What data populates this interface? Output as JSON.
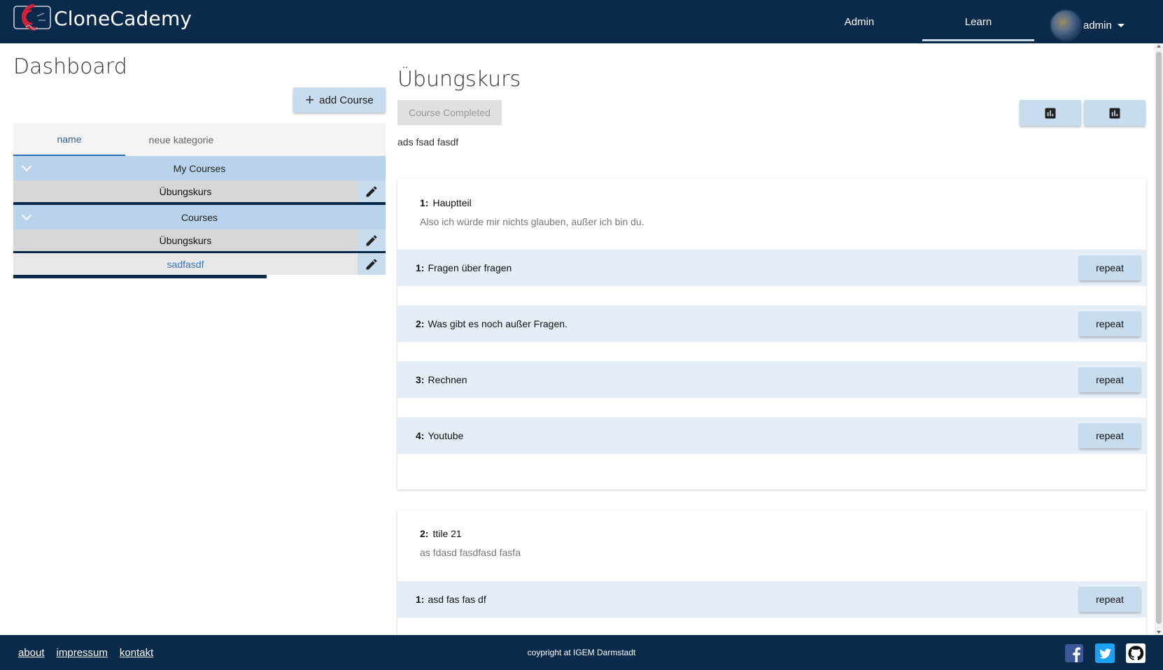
{
  "header": {
    "brand": "CloneCademy",
    "nav": {
      "admin": "Admin",
      "learn": "Learn"
    },
    "user": "admin"
  },
  "sidebar": {
    "title": "Dashboard",
    "add_course": "add Course",
    "tabs": [
      "name",
      "neue kategorie"
    ],
    "groups": [
      {
        "title": "My Courses",
        "items": [
          {
            "name": "Übungskurs",
            "progress": 1.0
          }
        ]
      },
      {
        "title": "Courses",
        "items": [
          {
            "name": "Übungskurs",
            "progress": 1.0
          },
          {
            "name": "sadfasdf",
            "progress": 0.68
          }
        ]
      }
    ]
  },
  "course": {
    "title": "Übungskurs",
    "completed_label": "Course Completed",
    "description": "ads fsad fasdf",
    "modules": [
      {
        "number": "1:",
        "title": "Hauptteil",
        "description": "Also ich würde mir nichts glauben, außer ich bin du.",
        "lessons": [
          {
            "number": "1:",
            "title": "Fragen über fragen",
            "action": "repeat"
          },
          {
            "number": "2:",
            "title": "Was gibt es noch außer Fragen.",
            "action": "repeat"
          },
          {
            "number": "3:",
            "title": "Rechnen",
            "action": "repeat"
          },
          {
            "number": "4:",
            "title": "Youtube",
            "action": "repeat"
          }
        ]
      },
      {
        "number": "2:",
        "title": "ttile 21",
        "description": "as fdasd fasdfasd fasfa",
        "lessons": [
          {
            "number": "1:",
            "title": "asd fas fas df",
            "action": "repeat"
          }
        ]
      }
    ]
  },
  "footer": {
    "links": [
      "about",
      "impressum",
      "kontakt"
    ],
    "copyright": "coypright at IGEM Darmstadt"
  },
  "colors": {
    "navy": "#0a2a4c",
    "light_blue": "#c8dcef",
    "row_blue": "#e5eef8",
    "accent": "#b9d3ec"
  }
}
